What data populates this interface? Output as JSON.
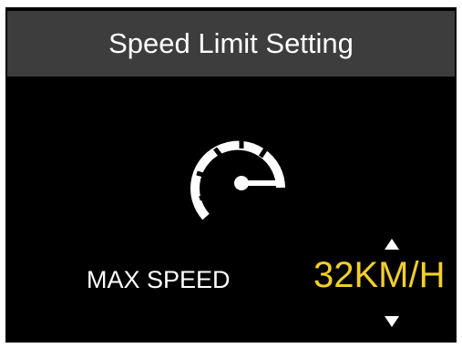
{
  "header": {
    "title": "Speed Limit Setting"
  },
  "setting": {
    "label": "MAX SPEED",
    "value": "32KM/H",
    "increase_icon": "triangle-up-icon",
    "decrease_icon": "triangle-down-icon"
  },
  "icons": {
    "speed": "speedometer-icon"
  },
  "colors": {
    "background": "#000000",
    "title_bar": "#3d3d3d",
    "text": "#ffffff",
    "accent": "#f2cf2b"
  }
}
